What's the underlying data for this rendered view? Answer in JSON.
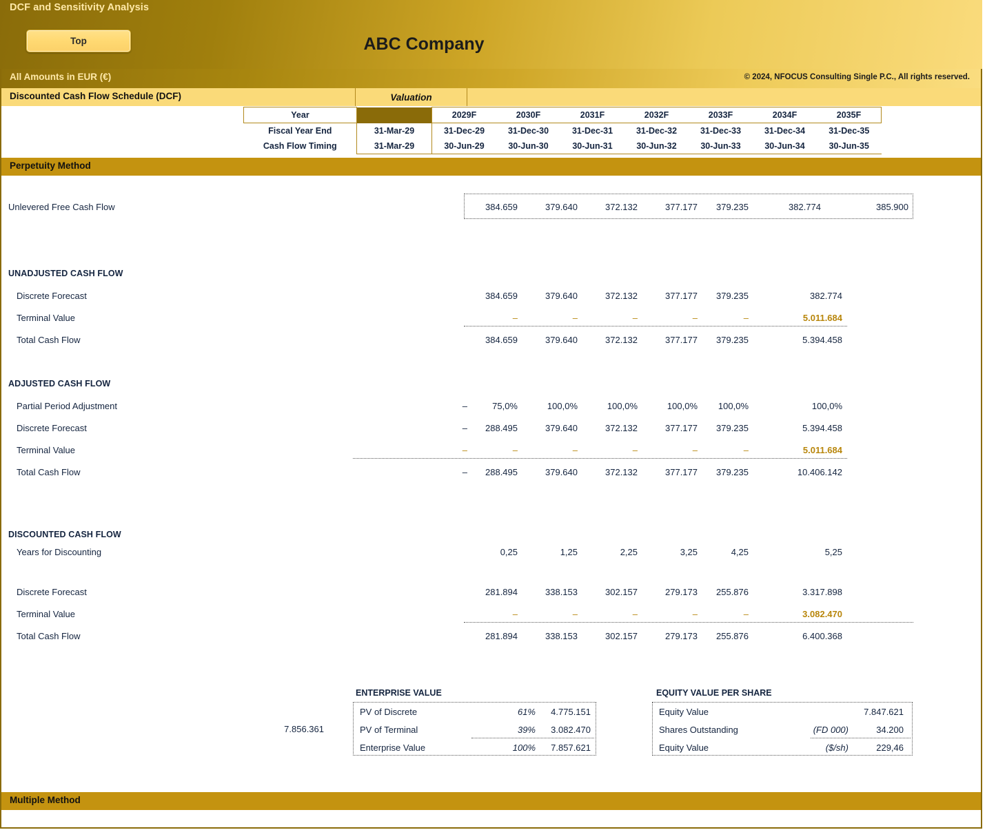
{
  "banner": {
    "title": "DCF and Sensitivity Analysis",
    "top_button": "Top",
    "company": "ABC Company"
  },
  "amounts_strip": {
    "label": "All Amounts in  EUR (€)",
    "copyright": "© 2024, NFOCUS Consulting Single P.C., All rights reserved."
  },
  "schedule": {
    "title": "Discounted Cash Flow Schedule (DCF)",
    "valuation_header": "Valuation"
  },
  "header_table": {
    "rows": [
      {
        "label": "Year",
        "valuation": "",
        "years": [
          "2029F",
          "2030F",
          "2031F",
          "2032F",
          "2033F",
          "2034F",
          "2035F"
        ]
      },
      {
        "label": "Fiscal Year End",
        "valuation": "31-Mar-29",
        "years": [
          "31-Dec-29",
          "31-Dec-30",
          "31-Dec-31",
          "31-Dec-32",
          "31-Dec-33",
          "31-Dec-34",
          "31-Dec-35"
        ]
      },
      {
        "label": "Cash Flow Timing",
        "valuation": "31-Mar-29",
        "years": [
          "30-Jun-29",
          "30-Jun-30",
          "30-Jun-31",
          "30-Jun-32",
          "30-Jun-33",
          "30-Jun-34",
          "30-Jun-35"
        ]
      }
    ]
  },
  "bands": {
    "perpetuity": "Perpetuity Method",
    "multiple": "Multiple Method"
  },
  "ufcf": {
    "label": "Unlevered Free Cash Flow",
    "values": [
      "384.659",
      "379.640",
      "372.132",
      "377.177",
      "379.235",
      "382.774",
      "385.900"
    ]
  },
  "unadjusted": {
    "title": "UNADJUSTED CASH FLOW",
    "discrete_label": "Discrete Forecast",
    "discrete_values": [
      "384.659",
      "379.640",
      "372.132",
      "377.177",
      "379.235",
      "382.774"
    ],
    "terminal_label": "Terminal Value",
    "terminal_values": [
      "–",
      "–",
      "–",
      "–",
      "–",
      "5.011.684"
    ],
    "total_label": "Total Cash Flow",
    "total_values": [
      "384.659",
      "379.640",
      "372.132",
      "377.177",
      "379.235",
      "5.394.458"
    ]
  },
  "adjusted": {
    "title": "ADJUSTED CASH FLOW",
    "ppa_label": "Partial Period Adjustment",
    "ppa_valuation": "–",
    "ppa_values": [
      "75,0%",
      "100,0%",
      "100,0%",
      "100,0%",
      "100,0%",
      "100,0%"
    ],
    "discrete_label": "Discrete Forecast",
    "discrete_valuation": "–",
    "discrete_values": [
      "288.495",
      "379.640",
      "372.132",
      "377.177",
      "379.235",
      "5.394.458"
    ],
    "terminal_label": "Terminal Value",
    "terminal_valuation": "–",
    "terminal_values": [
      "–",
      "–",
      "–",
      "–",
      "–",
      "5.011.684"
    ],
    "total_label": "Total Cash Flow",
    "total_valuation": "–",
    "total_values": [
      "288.495",
      "379.640",
      "372.132",
      "377.177",
      "379.235",
      "10.406.142"
    ]
  },
  "discounted": {
    "title": "DISCOUNTED CASH FLOW",
    "years_label": "Years for Discounting",
    "years_values": [
      "0,25",
      "1,25",
      "2,25",
      "3,25",
      "4,25",
      "5,25"
    ],
    "discrete_label": "Discrete Forecast",
    "discrete_values": [
      "281.894",
      "338.153",
      "302.157",
      "279.173",
      "255.876",
      "3.317.898"
    ],
    "terminal_label": "Terminal Value",
    "terminal_values": [
      "–",
      "–",
      "–",
      "–",
      "–",
      "3.082.470"
    ],
    "total_label": "Total Cash Flow",
    "total_values": [
      "281.894",
      "338.153",
      "302.157",
      "279.173",
      "255.876",
      "6.400.368"
    ]
  },
  "enterprise_value": {
    "title": "ENTERPRISE VALUE",
    "standalone_value": "7.856.361",
    "rows": [
      {
        "name": "PV of Discrete",
        "pct": "61%",
        "amount": "4.775.151"
      },
      {
        "name": "PV of Terminal",
        "pct": "39%",
        "amount": "3.082.470"
      },
      {
        "name": "Enterprise Value",
        "pct": "100%",
        "amount": "7.857.621"
      }
    ]
  },
  "equity_value": {
    "title": "EQUITY VALUE PER SHARE",
    "rows": [
      {
        "name": "Equity Value",
        "unit": "",
        "amount": "7.847.621"
      },
      {
        "name": "Shares Outstanding",
        "unit": "(FD 000)",
        "amount": "34.200"
      },
      {
        "name": "Equity Value",
        "unit": "($/sh)",
        "amount": "229,46"
      }
    ]
  },
  "colors": {
    "band": "#c49310",
    "header_yellow": "#fada79",
    "gold_text": "#b8860b",
    "dark_gold": "#8a6b09"
  }
}
